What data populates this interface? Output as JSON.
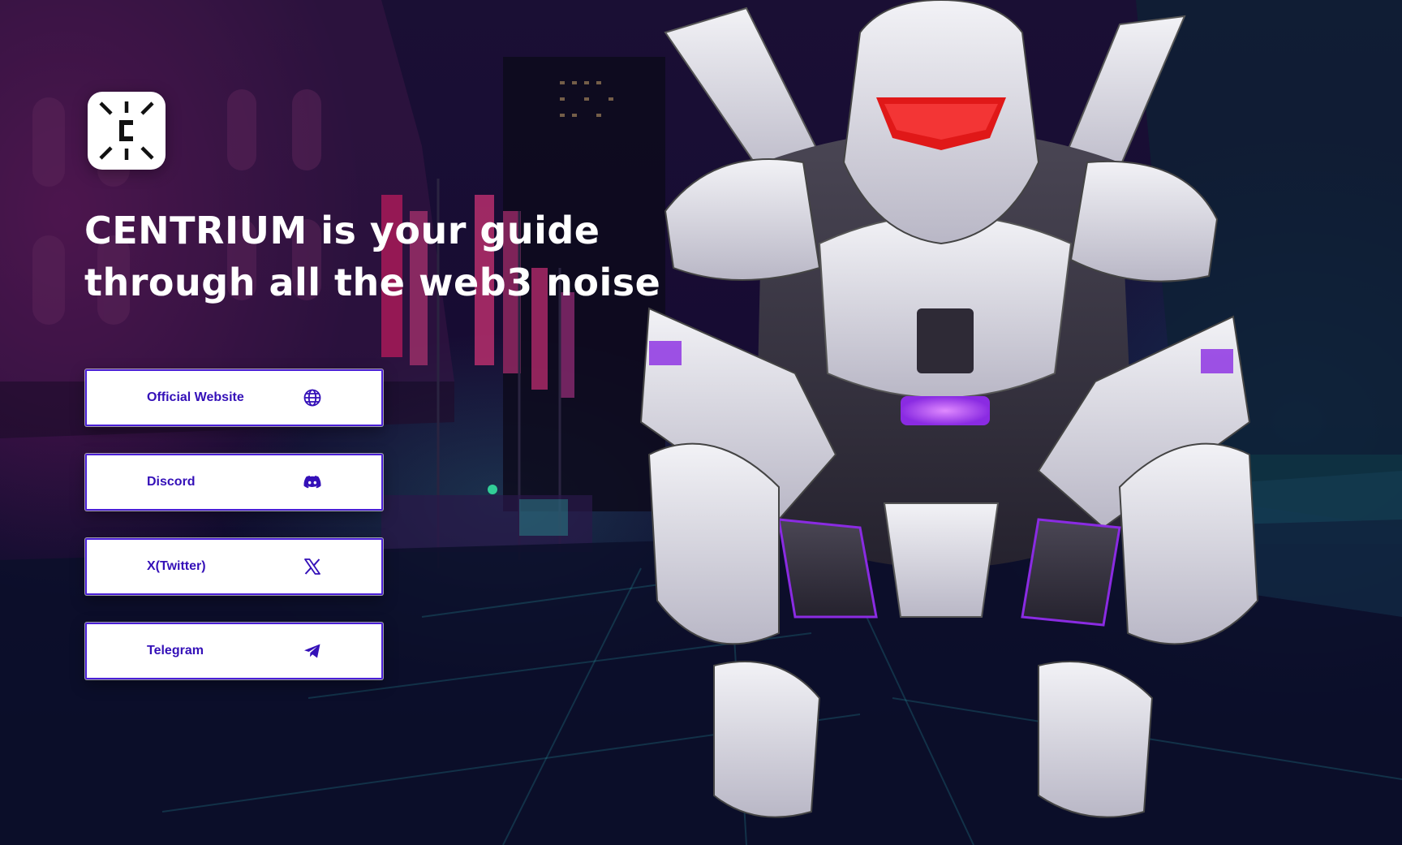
{
  "brand": {
    "logo_icon": "centrium-logo-icon",
    "logo_letter": "C"
  },
  "headline": {
    "line1": "CENTRIUM is your guide",
    "line2": "through all the web3 noise"
  },
  "links": [
    {
      "label": "Official Website",
      "icon": "globe-icon"
    },
    {
      "label": "Discord",
      "icon": "discord-icon"
    },
    {
      "label": "X(Twitter)",
      "icon": "x-icon"
    },
    {
      "label": "Telegram",
      "icon": "telegram-icon"
    }
  ],
  "colors": {
    "accent": "#3410b8",
    "button_border": "#4a1fd6",
    "button_bg": "#ffffff",
    "headline": "#ffffff",
    "robot_accent": "#8a2be2",
    "visor": "#ff2a2a"
  }
}
